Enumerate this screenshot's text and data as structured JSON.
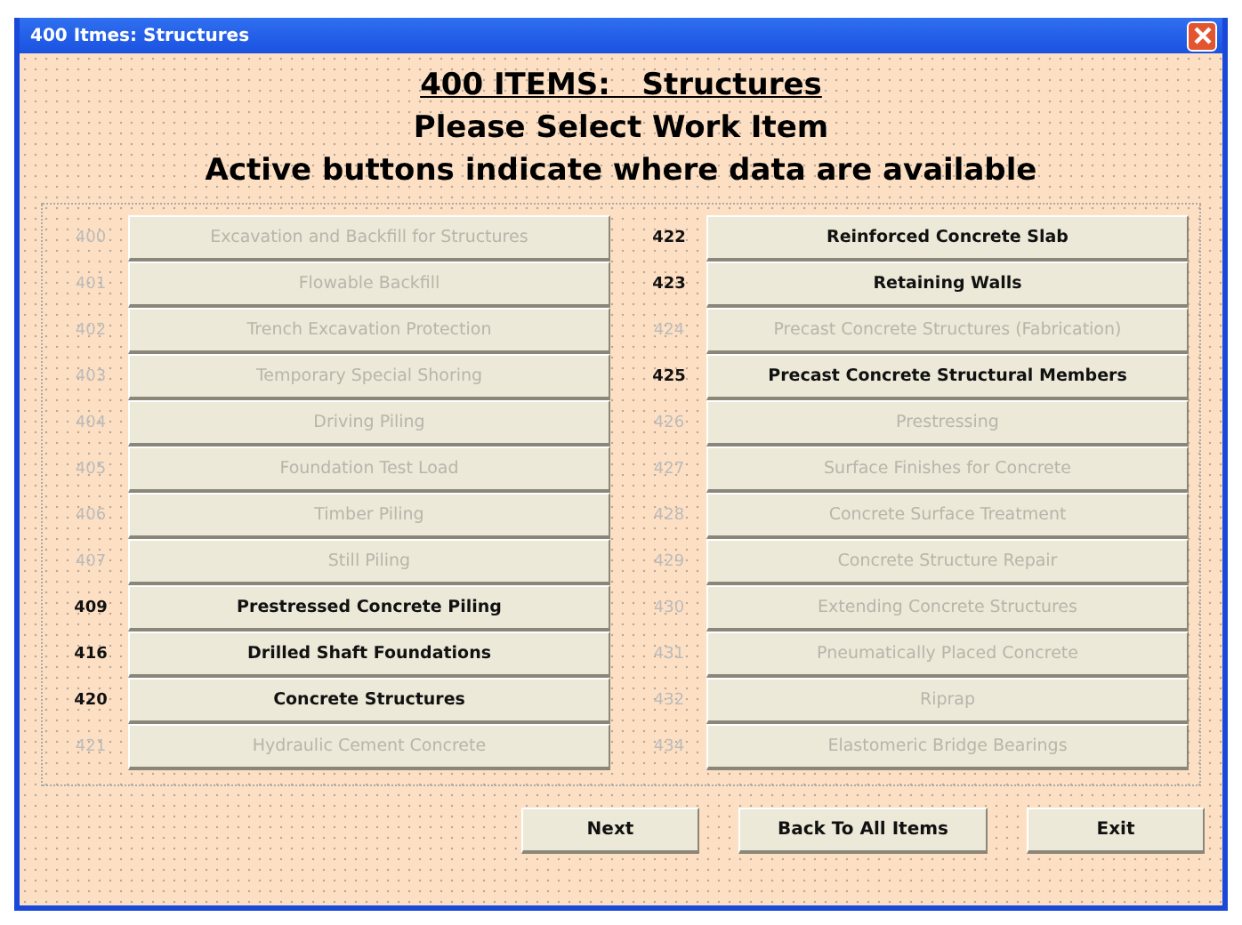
{
  "window": {
    "title": "400 Itmes: Structures"
  },
  "heading": {
    "title": "400 ITEMS:   Structures",
    "subtitle": "Please Select Work Item",
    "note": "Active buttons indicate where data are available"
  },
  "columns": [
    [
      {
        "code": "400",
        "label": "Excavation and Backfill for Structures",
        "active": false
      },
      {
        "code": "401",
        "label": "Flowable Backfill",
        "active": false
      },
      {
        "code": "402",
        "label": "Trench Excavation Protection",
        "active": false
      },
      {
        "code": "403",
        "label": "Temporary Special Shoring",
        "active": false
      },
      {
        "code": "404",
        "label": "Driving Piling",
        "active": false
      },
      {
        "code": "405",
        "label": "Foundation Test Load",
        "active": false
      },
      {
        "code": "406",
        "label": "Timber Piling",
        "active": false
      },
      {
        "code": "407",
        "label": "Still Piling",
        "active": false
      },
      {
        "code": "409",
        "label": "Prestressed Concrete Piling",
        "active": true
      },
      {
        "code": "416",
        "label": "Drilled Shaft Foundations",
        "active": true
      },
      {
        "code": "420",
        "label": "Concrete Structures",
        "active": true
      },
      {
        "code": "421",
        "label": "Hydraulic Cement Concrete",
        "active": false
      }
    ],
    [
      {
        "code": "422",
        "label": "Reinforced Concrete Slab",
        "active": true
      },
      {
        "code": "423",
        "label": "Retaining Walls",
        "active": true
      },
      {
        "code": "424",
        "label": "Precast Concrete Structures (Fabrication)",
        "active": false
      },
      {
        "code": "425",
        "label": "Precast Concrete Structural Members",
        "active": true
      },
      {
        "code": "426",
        "label": "Prestressing",
        "active": false
      },
      {
        "code": "427",
        "label": "Surface Finishes for Concrete",
        "active": false
      },
      {
        "code": "428",
        "label": "Concrete Surface Treatment",
        "active": false
      },
      {
        "code": "429",
        "label": "Concrete Structure Repair",
        "active": false
      },
      {
        "code": "430",
        "label": "Extending Concrete Structures",
        "active": false
      },
      {
        "code": "431",
        "label": "Pneumatically Placed Concrete",
        "active": false
      },
      {
        "code": "432",
        "label": "Riprap",
        "active": false
      },
      {
        "code": "434",
        "label": "Elastomeric Bridge Bearings",
        "active": false
      }
    ]
  ],
  "buttons": [
    "Next",
    "Back To All Items",
    "Exit"
  ]
}
